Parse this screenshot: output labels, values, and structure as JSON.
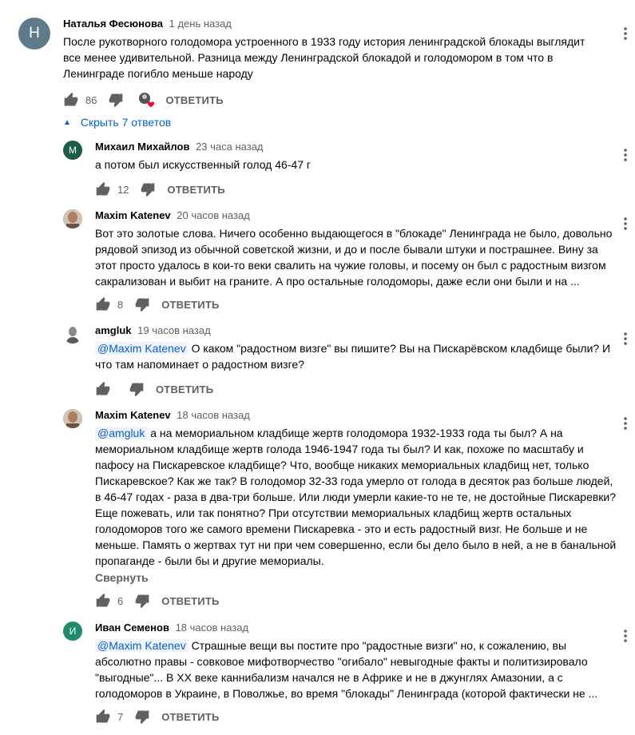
{
  "top_comment": {
    "avatar_letter": "Н",
    "avatar_color": "#5f7a8a",
    "author": "Наталья Фесюнова",
    "time": "1 день назад",
    "lines": [
      "После рукотворного голодомора устроенного в 1933 году история ленинградской блокады выглядит",
      "все менее удивительной. Разница между Ленинградской блокадой и голодомором в том что в",
      "Ленинграде погибло меньше народу"
    ],
    "likes": "86",
    "reply_label": "ОТВЕТИТЬ"
  },
  "toggle_replies_label": "Скрыть 7 ответов",
  "replies": [
    {
      "avatar_letter": "М",
      "avatar_color": "#1b5e45",
      "author": "Михаил Михайлов",
      "time": "23 часа назад",
      "lines": [
        "а потом был искусственный голод 46-47 г"
      ],
      "likes": "12",
      "reply_label": "ОТВЕТИТЬ"
    },
    {
      "avatar_letter": "",
      "avatar_color": "#b89078",
      "author": "Maxim Katenev",
      "time": "20 часов назад",
      "lines": [
        "Вот это золотые слова. Ничего особенно выдающегося в \"блокаде\" Ленинграда не было, довольно",
        "рядовой эпизод из обычной советской жизни, и до и после бывали штуки и пострашнее. Вину за",
        "этот просто удалось в кои-то веки свалить на чужие головы, и посему он был с радостным визгом",
        "сакрализован и выбит на граните. А про остальные голодоморы, даже если они были и на ..."
      ],
      "likes": "8",
      "reply_label": "ОТВЕТИТЬ"
    },
    {
      "avatar_letter": "",
      "avatar_color": "#d8d8d8",
      "author": "amgluk",
      "time": "19 часов назад",
      "mention": "@Maxim Katenev",
      "lines": [
        " О каком \"радостном визге\" вы пишите? Вы на Пискарёвском кладбище были? И",
        "что там напоминает о радостном визге?"
      ],
      "likes": "",
      "reply_label": "ОТВЕТИТЬ"
    },
    {
      "avatar_letter": "",
      "avatar_color": "#b89078",
      "author": "Maxim Katenev",
      "time": "18 часов назад",
      "mention": "@amgluk",
      "lines": [
        " а на мемориальном кладбище жертв голодомора 1932-1933 года ты был? А на",
        "мемориальном кладбище жертв голода 1946-1947 года ты был? И как, похоже по масштабу и",
        "пафосу на Пискаревское кладбище? Что, вообще никаких мемориальных кладбищ нет, только",
        "Пискаревское? Как же так? В голодомор 32-33 года умерло от голода в десяток раз больше людей,",
        "в 46-47 годах - раза в два-три больше. Или люди умерли какие-то не те, не достойные Пискаревки?",
        "Еще пожевать, или так понятно? При отсутствии мемориальных кладбищ жертв остальных",
        "голодоморов того же самого времени Пискаревка - это и есть радостный визг. Не больше и не",
        "меньше. Память о жертвах тут ни при чем совершенно, если бы дело было в ней, а не в банальной",
        "пропаганде - были бы и другие мемориалы."
      ],
      "collapse_label": "Свернуть",
      "likes": "6",
      "reply_label": "ОТВЕТИТЬ"
    },
    {
      "avatar_letter": "И",
      "avatar_color": "#1e8a6e",
      "author": "Иван Семенов",
      "time": "18 часов назад",
      "mention": "@Maxim Katenev",
      "lines": [
        " Страшные вещи вы постите про \"радостные визги\" но, к сожалению, вы",
        "абсолютно правы - совковое мифотворчество \"огибало\" невыгодные факты и политизировало",
        "\"выгодные\"... В XX веке каннибализм начался не в Африке и не в джунглях Амазонии, а с",
        "голодоморов в Украине, в Поволжье, во время \"блокады\" Ленинграда (которой фактически не ..."
      ],
      "likes": "7",
      "reply_label": "ОТВЕТИТЬ"
    }
  ]
}
